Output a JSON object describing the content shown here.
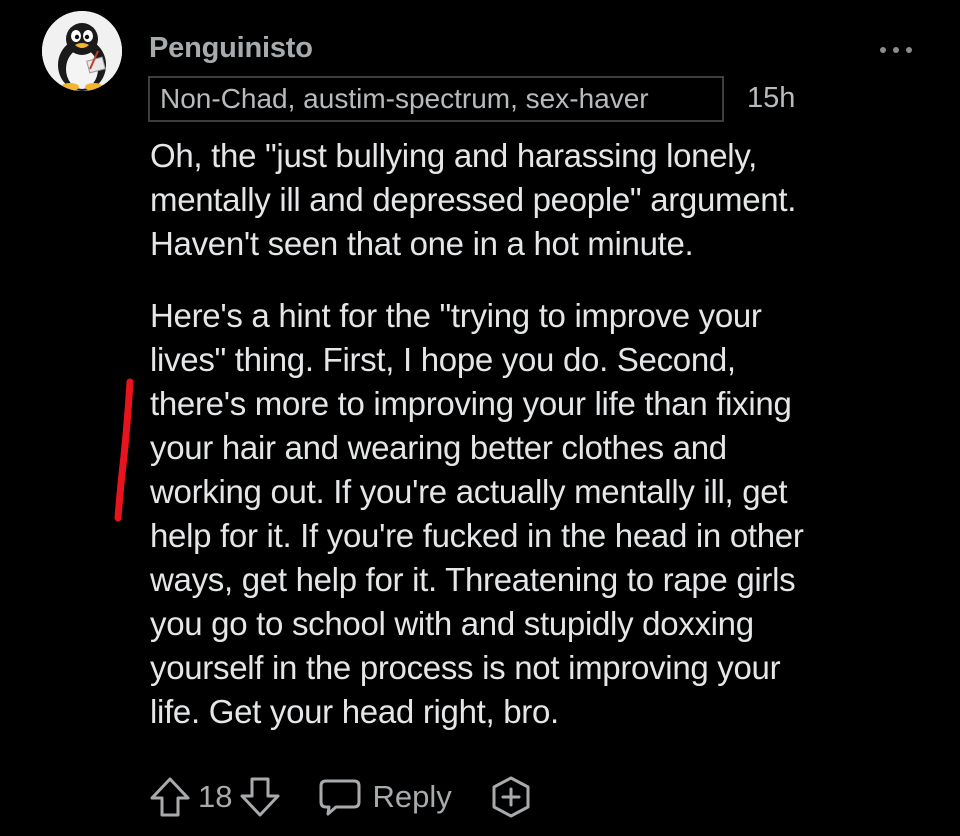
{
  "comment": {
    "username": "Penguinisto",
    "flair": "Non-Chad, austim-spectrum, sex-haver",
    "timestamp": "15h",
    "paragraphs": [
      "Oh, the \"just bullying and harassing lonely,\nmentally ill and depressed people\" argument.\nHaven't seen that one in a hot minute.",
      "Here's a hint for the \"trying to improve your\nlives\" thing. First, I hope you do. Second,\nthere's more to improving your life than fixing\nyour hair and wearing better clothes and\nworking out. If you're actually mentally ill, get\nhelp for it. If you're fucked in the head in other\nways, get help for it. Threatening to rape girls\nyou go to school with and stupidly doxxing\nyourself in the process is not improving your\nlife. Get your head right, bro."
    ],
    "vote_count": "18",
    "reply_label": "Reply"
  },
  "icons": {
    "avatar": "penguin-avatar",
    "more": "more-options-icon",
    "upvote": "upvote-arrow-icon",
    "downvote": "downvote-arrow-icon",
    "reply": "speech-bubble-icon",
    "award": "award-plus-icon"
  },
  "colors": {
    "background": "#000000",
    "text": "#e4e6e8",
    "muted": "#a8abae",
    "annotation_mark": "#e8141d"
  }
}
